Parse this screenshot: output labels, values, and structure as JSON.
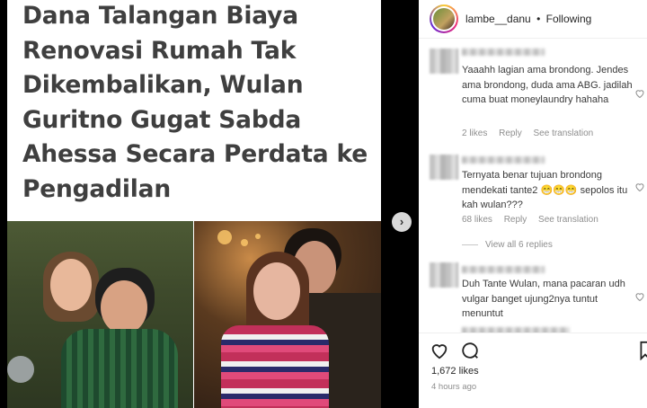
{
  "post": {
    "headline": "Dana Talangan Biaya Renovasi Rumah Tak Dikembalikan, Wulan Guritno Gugat Sabda Ahessa Secara Perdata ke Pengadilan"
  },
  "header": {
    "username": "lambe__danu",
    "separator": "•",
    "follow_status": "Following"
  },
  "comments": [
    {
      "text": "Yaaahh lagian ama brondong. Jendes ama brondong, duda ama ABG. jadilah cuma buat moneylaundry hahaha",
      "likes": "2 likes",
      "reply": "Reply",
      "translation": "See translation"
    },
    {
      "text": "Ternyata benar tujuan brondong mendekati tante2 😁😁😁 sepolos itu kah wulan???",
      "likes": "68 likes",
      "reply": "Reply",
      "translation": "See translation",
      "view_replies": "View all 6 replies"
    },
    {
      "text": "Duh Tante Wulan, mana pacaran udh vulgar banget ujung2nya tuntut menuntut"
    }
  ],
  "footer": {
    "likes": "1,672 likes",
    "time": "4 hours ago"
  },
  "icons": {
    "next": "chevron-right-icon",
    "like": "heart-icon",
    "comment": "comment-bubble-icon",
    "save": "bookmark-icon"
  },
  "colors": {
    "headline": "#3f3f3f",
    "meta": "#8e8e8e",
    "text": "#262626"
  }
}
